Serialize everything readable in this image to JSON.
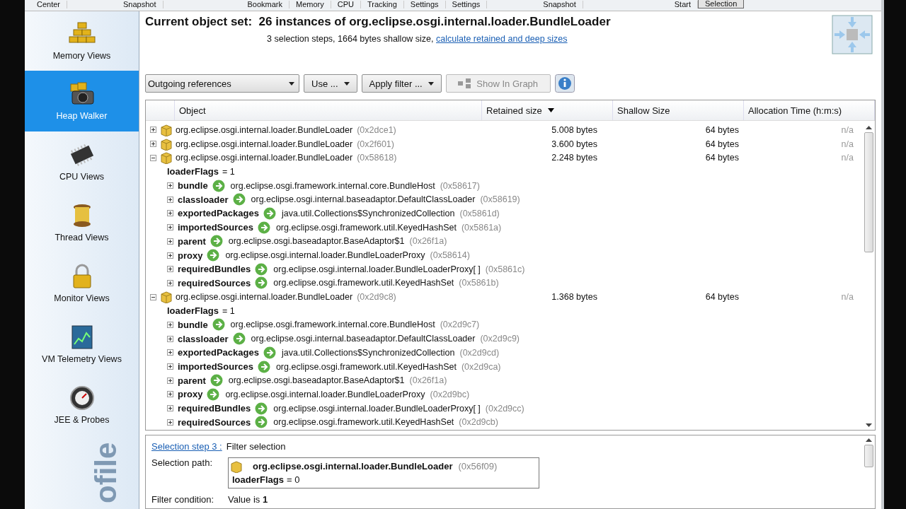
{
  "toolbar_labels": [
    {
      "label": "Center",
      "selected": false
    },
    {
      "label": "Snapshot",
      "selected": false
    },
    {
      "label": "Bookmark",
      "selected": false
    },
    {
      "label": "Memory",
      "selected": false
    },
    {
      "label": "CPU",
      "selected": false
    },
    {
      "label": "Tracking",
      "selected": false
    },
    {
      "label": "Settings",
      "selected": false
    },
    {
      "label": "Settings",
      "selected": false
    },
    {
      "label": "Snapshot",
      "selected": false
    },
    {
      "label": "Start",
      "selected": false
    },
    {
      "label": "Selection",
      "selected": true
    }
  ],
  "sidebar": {
    "brand_text": "ofile",
    "items": [
      {
        "label": "Memory Views",
        "selected": false
      },
      {
        "label": "Heap Walker",
        "selected": true
      },
      {
        "label": "CPU Views",
        "selected": false
      },
      {
        "label": "Thread Views",
        "selected": false
      },
      {
        "label": "Monitor Views",
        "selected": false
      },
      {
        "label": "VM Telemetry Views",
        "selected": false
      },
      {
        "label": "JEE & Probes",
        "selected": false
      }
    ]
  },
  "header": {
    "title_prefix": "Current object set:",
    "title": "26 instances of org.eclipse.osgi.internal.loader.BundleLoader",
    "summary": "3 selection steps, 1664 bytes shallow size,",
    "link": "calculate retained and deep sizes"
  },
  "controls": {
    "view_select": "Outgoing references",
    "use_button": "Use ...",
    "filter_button": "Apply filter ...",
    "graph_button": {
      "label": "Show In Graph",
      "disabled": true
    }
  },
  "table": {
    "columns": [
      {
        "label": "Object",
        "sorted": false
      },
      {
        "label": "Retained size",
        "sorted": true
      },
      {
        "label": "Shallow Size",
        "sorted": false
      },
      {
        "label": "Allocation Time (h:m:s)",
        "sorted": false
      }
    ],
    "rows": [
      {
        "class": "org.eclipse.osgi.internal.loader.BundleLoader",
        "address": "(0x2dce1)",
        "retained": "5.008 bytes",
        "shallow": "64 bytes",
        "time": "n/a",
        "expanded": false
      },
      {
        "class": "org.eclipse.osgi.internal.loader.BundleLoader",
        "address": "(0x2f601)",
        "retained": "3.600 bytes",
        "shallow": "64 bytes",
        "time": "n/a",
        "expanded": false
      },
      {
        "class": "org.eclipse.osgi.internal.loader.BundleLoader",
        "address": "(0x58618)",
        "retained": "2.248 bytes",
        "shallow": "64 bytes",
        "time": "n/a",
        "expanded": true,
        "children": [
          {
            "kind": "value",
            "field": "loaderFlags",
            "value": "= 1"
          },
          {
            "kind": "ref",
            "field": "bundle",
            "class": "org.eclipse.osgi.framework.internal.core.BundleHost",
            "address": "(0x58617)"
          },
          {
            "kind": "ref",
            "field": "classloader",
            "class": "org.eclipse.osgi.internal.baseadaptor.DefaultClassLoader",
            "address": "(0x58619)"
          },
          {
            "kind": "ref",
            "field": "exportedPackages",
            "class": "java.util.Collections$SynchronizedCollection",
            "address": "(0x5861d)"
          },
          {
            "kind": "ref",
            "field": "importedSources",
            "class": "org.eclipse.osgi.framework.util.KeyedHashSet",
            "address": "(0x5861a)"
          },
          {
            "kind": "ref",
            "field": "parent",
            "class": "org.eclipse.osgi.baseadaptor.BaseAdaptor$1",
            "address": "(0x26f1a)"
          },
          {
            "kind": "ref",
            "field": "proxy",
            "class": "org.eclipse.osgi.internal.loader.BundleLoaderProxy",
            "address": "(0x58614)"
          },
          {
            "kind": "ref",
            "field": "requiredBundles",
            "class": "org.eclipse.osgi.internal.loader.BundleLoaderProxy[ ]",
            "address": "(0x5861c)"
          },
          {
            "kind": "ref",
            "field": "requiredSources",
            "class": "org.eclipse.osgi.framework.util.KeyedHashSet",
            "address": "(0x5861b)"
          }
        ]
      },
      {
        "class": "org.eclipse.osgi.internal.loader.BundleLoader",
        "address": "(0x2d9c8)",
        "retained": "1.368 bytes",
        "shallow": "64 bytes",
        "time": "n/a",
        "expanded": true,
        "children": [
          {
            "kind": "value",
            "field": "loaderFlags",
            "value": "= 1"
          },
          {
            "kind": "ref",
            "field": "bundle",
            "class": "org.eclipse.osgi.framework.internal.core.BundleHost",
            "address": "(0x2d9c7)"
          },
          {
            "kind": "ref",
            "field": "classloader",
            "class": "org.eclipse.osgi.internal.baseadaptor.DefaultClassLoader",
            "address": "(0x2d9c9)"
          },
          {
            "kind": "ref",
            "field": "exportedPackages",
            "class": "java.util.Collections$SynchronizedCollection",
            "address": "(0x2d9cd)"
          },
          {
            "kind": "ref",
            "field": "importedSources",
            "class": "org.eclipse.osgi.framework.util.KeyedHashSet",
            "address": "(0x2d9ca)"
          },
          {
            "kind": "ref",
            "field": "parent",
            "class": "org.eclipse.osgi.baseadaptor.BaseAdaptor$1",
            "address": "(0x26f1a)"
          },
          {
            "kind": "ref",
            "field": "proxy",
            "class": "org.eclipse.osgi.internal.loader.BundleLoaderProxy",
            "address": "(0x2d9bc)"
          },
          {
            "kind": "ref",
            "field": "requiredBundles",
            "class": "org.eclipse.osgi.internal.loader.BundleLoaderProxy[ ]",
            "address": "(0x2d9cc)"
          },
          {
            "kind": "ref",
            "field": "requiredSources",
            "class": "org.eclipse.osgi.framework.util.KeyedHashSet",
            "address": "(0x2d9cb)"
          }
        ]
      }
    ]
  },
  "step_panel": {
    "step_link": "Selection step 3 :",
    "step_title": "Filter selection",
    "path_label": "Selection path:",
    "path_class": "org.eclipse.osgi.internal.loader.BundleLoader",
    "path_address": "(0x56f09)",
    "path_field": "loaderFlags",
    "path_value": "= 0",
    "condition_label": "Filter condition:",
    "condition_text": "Value is **1**"
  }
}
